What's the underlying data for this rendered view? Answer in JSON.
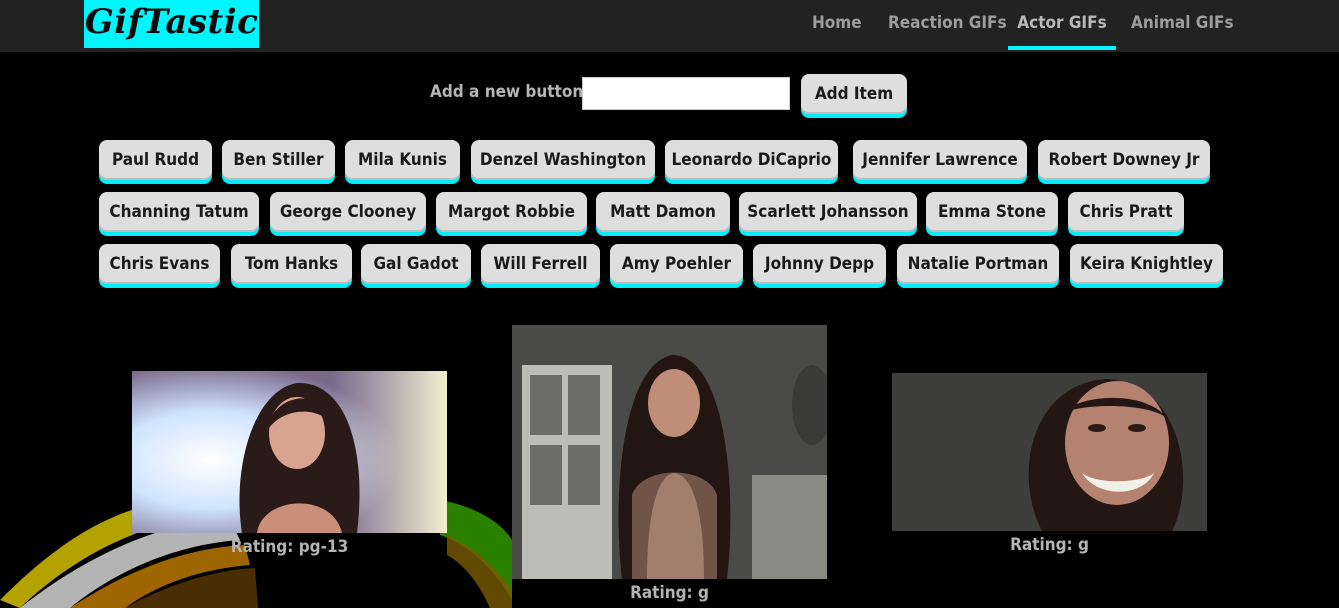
{
  "brand": {
    "title": "GifTastic",
    "color": "#00f6ff"
  },
  "nav": {
    "items": [
      {
        "label": "Home"
      },
      {
        "label": "Reaction GIFs"
      },
      {
        "label": "Actor GIFs",
        "active": true
      },
      {
        "label": "Animal GIFs"
      }
    ]
  },
  "add_form": {
    "label": "Add a new button:",
    "input_value": "",
    "button_label": "Add Item"
  },
  "topic_buttons": [
    "Paul Rudd",
    "Ben Stiller",
    "Mila Kunis",
    "Denzel Washington",
    "Leonardo DiCaprio",
    "Jennifer Lawrence",
    "Robert Downey Jr",
    "Channing Tatum",
    "George Clooney",
    "Margot Robbie",
    "Matt Damon",
    "Scarlett Johansson",
    "Emma Stone",
    "Chris Pratt",
    "Chris Evans",
    "Tom Hanks",
    "Gal Gadot",
    "Will Ferrell",
    "Amy Poehler",
    "Johnny Depp",
    "Natalie Portman",
    "Keira Knightley"
  ],
  "gifs": [
    {
      "rating": "Rating: pg-13"
    },
    {
      "rating": "Rating: g"
    },
    {
      "rating": "Rating: g"
    }
  ],
  "colors": {
    "accent": "#00f6ff",
    "navbar": "#222222",
    "background": "#000000",
    "button": "#dedede"
  }
}
